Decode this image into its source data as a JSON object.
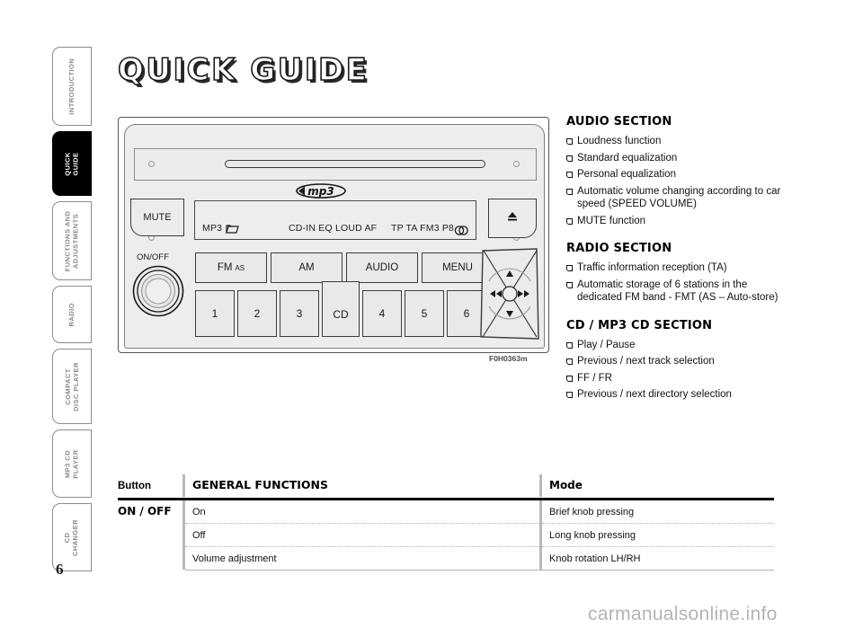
{
  "page": {
    "title": "QUICK GUIDE",
    "number": "6",
    "watermark": "carmanualsonline.info"
  },
  "sidebar": {
    "items": [
      {
        "label": "INTRODUCTION",
        "active": false
      },
      {
        "label": "QUICK\nGUIDE",
        "active": true
      },
      {
        "label": "FUNCTIONS AND\nADJUSTMENTS",
        "active": false
      },
      {
        "label": "RADIO",
        "active": false
      },
      {
        "label": "COMPACT\nDISC PLAYER",
        "active": false
      },
      {
        "label": "MP3 CD\nPLAYER",
        "active": false
      },
      {
        "label": "CD\nCHANGER",
        "active": false
      }
    ]
  },
  "radio": {
    "caption": "F0H0363m",
    "logo": "mp3",
    "mute_label": "MUTE",
    "eject_label": "eject-symbol",
    "onoff_label": "ON/OFF",
    "display": {
      "left": "MP3",
      "folder_icon": "folder-icon",
      "center": "CD-IN EQ LOUD AF",
      "right": "TP TA FM3 P8",
      "stereo_icon": "stereo-icon"
    },
    "function_buttons": [
      {
        "label": "FM",
        "sub": "AS"
      },
      {
        "label": "AM",
        "sub": ""
      },
      {
        "label": "AUDIO",
        "sub": ""
      },
      {
        "label": "MENU",
        "sub": ""
      }
    ],
    "preset_buttons": [
      "1",
      "2",
      "3",
      "CD",
      "4",
      "5",
      "6"
    ],
    "dpad": {
      "up": "▲",
      "down": "▼",
      "left": "◄◄",
      "right": "►►"
    }
  },
  "sections": [
    {
      "heading": "AUDIO SECTION",
      "items": [
        "Loudness function",
        "Standard equalization",
        "Personal equalization",
        "Automatic volume changing according to car speed (SPEED VOLUME)",
        "MUTE function"
      ]
    },
    {
      "heading": "RADIO SECTION",
      "items": [
        "Traffic information reception (TA)",
        "Automatic storage of 6 stations in the dedicated FM band - FMT (AS – Auto-store)"
      ]
    },
    {
      "heading": "CD / MP3 CD SECTION",
      "items": [
        "Play / Pause",
        "Previous / next track selection",
        "FF / FR",
        "Previous / next directory selection"
      ]
    }
  ],
  "table": {
    "headers": {
      "button": "Button",
      "functions": "GENERAL FUNCTIONS",
      "mode": "Mode"
    },
    "group_label": "ON / OFF",
    "rows": [
      {
        "function": "On",
        "mode": "Brief knob pressing"
      },
      {
        "function": "Off",
        "mode": "Long knob pressing"
      },
      {
        "function": "Volume adjustment",
        "mode": "Knob rotation LH/RH"
      }
    ]
  },
  "colors": {
    "active_tab_bg": "#000000",
    "tab_text": "#8a8a8a",
    "panel_bg": "#ededed",
    "watermark": "#b4b4b4"
  }
}
